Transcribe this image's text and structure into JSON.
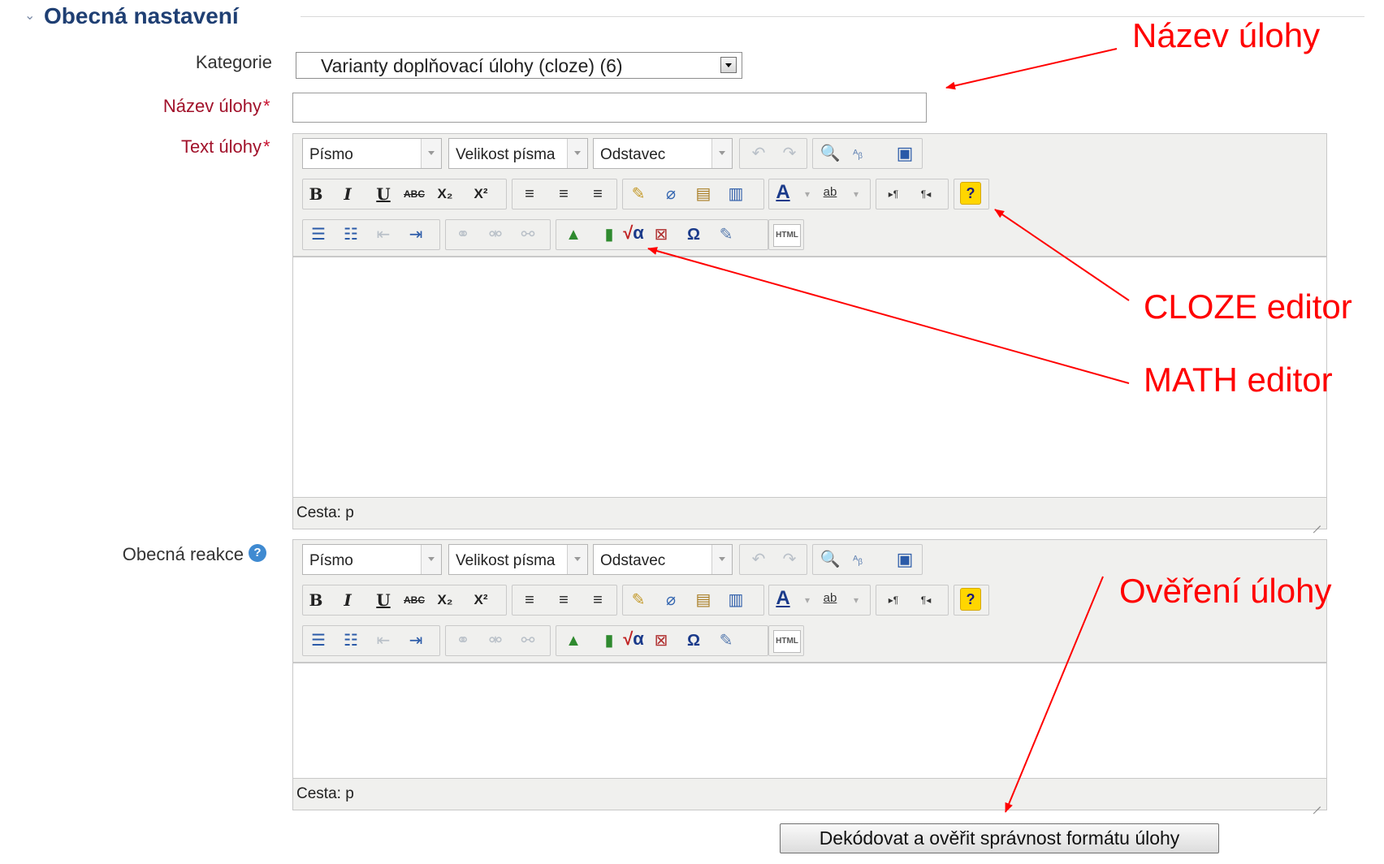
{
  "section": {
    "title": "Obecná nastavení"
  },
  "form": {
    "category_label": "Kategorie",
    "category_value": "Varianty doplňovací úlohy (cloze) (6)",
    "name_label": "Název úlohy",
    "name_value": "",
    "text_label": "Text úlohy",
    "feedback_label": "Obecná reakce",
    "required_mark": "*"
  },
  "toolbar": {
    "font": "Písmo",
    "font_size": "Velikost písma",
    "paragraph": "Odstavec",
    "bold": "B",
    "italic": "I",
    "underline": "U",
    "strikethrough": "ABC",
    "subscript": "X₂",
    "superscript": "X²",
    "textcolor": "A",
    "highlight": "ab",
    "ltr": "▸¶",
    "rtl": "¶◂",
    "help": "?",
    "omega": "Ω",
    "html": "HTML",
    "sqrt": "√α"
  },
  "editor": {
    "path": "Cesta: p"
  },
  "submit_label": "Dekódovat a ověřit správnost formátu úlohy",
  "help_icon": "?",
  "annotations": {
    "name": "Název úlohy",
    "cloze": "CLOZE editor",
    "math": "MATH editor",
    "verify": "Ověření úlohy",
    "color": "#ff0000"
  },
  "icons": [
    "chevron-down-icon",
    "binoculars-icon",
    "find-replace-icon",
    "fullscreen-icon",
    "brush-icon",
    "eraser-icon",
    "paste-text-icon",
    "paste-word-icon",
    "image-icon",
    "media-icon",
    "math-icon",
    "anchor-icon",
    "special-char-icon",
    "edit-icon",
    "bullet-list-icon",
    "numbered-list-icon",
    "outdent-icon",
    "indent-icon",
    "link-icon",
    "unlink-icon",
    "undo-icon",
    "redo-icon",
    "help-circle-icon",
    "resize-grip-icon"
  ]
}
